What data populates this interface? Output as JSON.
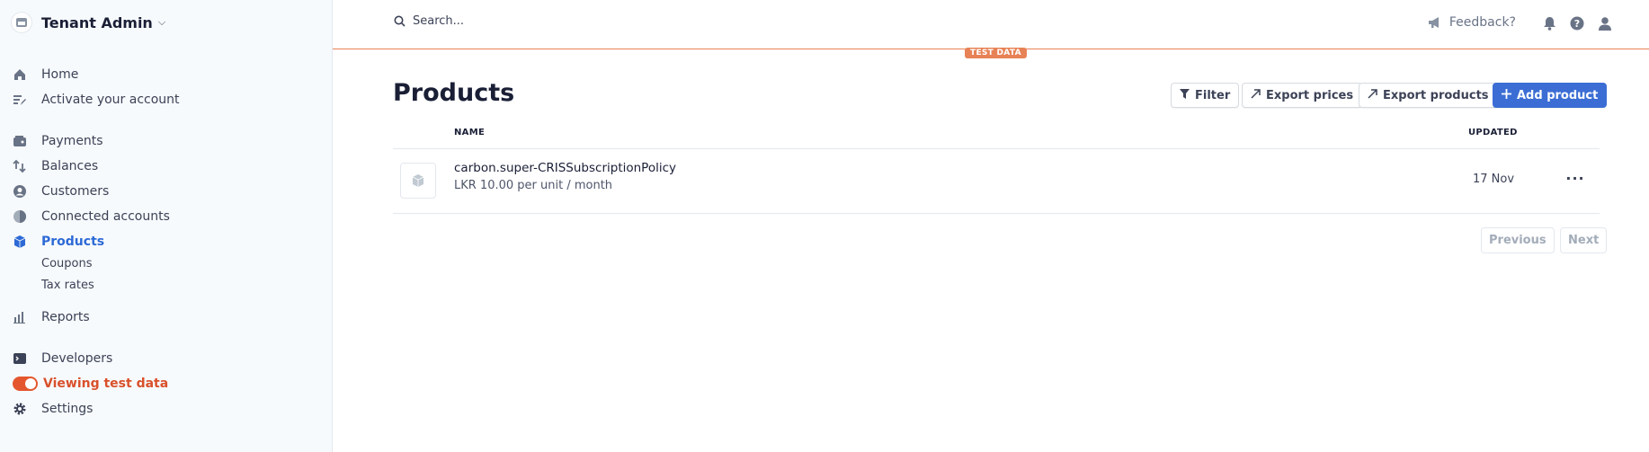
{
  "account": {
    "name": "Tenant Admin"
  },
  "nav": {
    "home": "Home",
    "activate": "Activate your account",
    "payments": "Payments",
    "balances": "Balances",
    "customers": "Customers",
    "connected": "Connected accounts",
    "products": "Products",
    "coupons": "Coupons",
    "tax_rates": "Tax rates",
    "reports": "Reports",
    "developers": "Developers",
    "viewing_test": "Viewing test data",
    "settings": "Settings"
  },
  "topbar": {
    "search_placeholder": "Search...",
    "feedback": "Feedback?",
    "test_badge": "TEST DATA"
  },
  "page": {
    "title": "Products",
    "buttons": {
      "filter": "Filter",
      "export_prices": "Export prices",
      "export_products": "Export products",
      "add_product": "Add product"
    },
    "columns": {
      "name": "NAME",
      "updated": "UPDATED"
    },
    "rows": [
      {
        "name": "carbon.super-CRISSubscriptionPolicy",
        "price": "LKR 10.00 per unit / month",
        "updated": "17 Nov"
      }
    ],
    "pagination": {
      "previous": "Previous",
      "next": "Next"
    }
  },
  "colors": {
    "accent": "#3b6dd4",
    "test_data": "#e78256",
    "active_nav": "#2d6ad6"
  }
}
